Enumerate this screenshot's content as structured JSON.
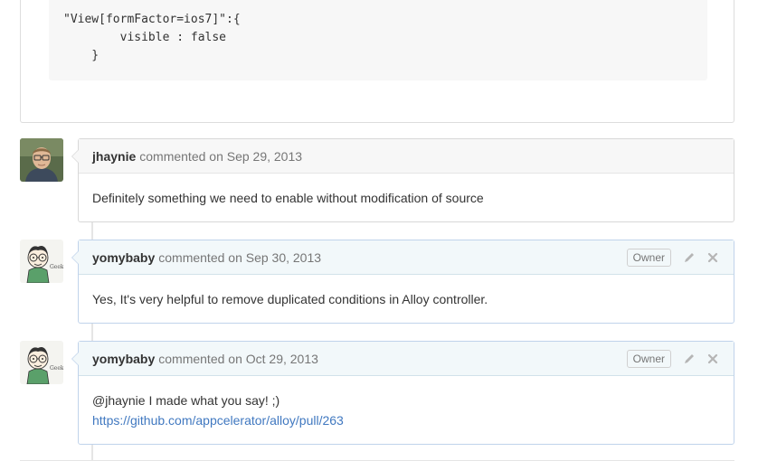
{
  "code_block": {
    "lines": [
      "\"View[formFactor=ios7]\":{",
      "        visible : false",
      "    }"
    ]
  },
  "comments": [
    {
      "author": "jhaynie",
      "action": "commented on Sep 29, 2013",
      "body": "Definitely something we need to enable without modification of source",
      "avatar": "user-photo-icon"
    },
    {
      "author": "yomybaby",
      "action": "commented on Sep 30, 2013",
      "badge": "Owner",
      "body": "Yes, It's very helpful to remove duplicated conditions in Alloy controller.",
      "avatar": "geek-cartoon-avatar-icon",
      "avatar_text": "Geek"
    },
    {
      "author": "yomybaby",
      "action": "commented on Oct 29, 2013",
      "badge": "Owner",
      "body": "@jhaynie I made what you say! ;)",
      "link": "https://github.com/appcelerator/alloy/pull/263",
      "avatar": "geek-cartoon-avatar-icon",
      "avatar_text": "Geek"
    }
  ],
  "colors": {
    "link": "#4078c0",
    "owner_header_bg": "#f2f8fa",
    "default_header_bg": "#f7f7f7",
    "meta_text": "#767676"
  }
}
